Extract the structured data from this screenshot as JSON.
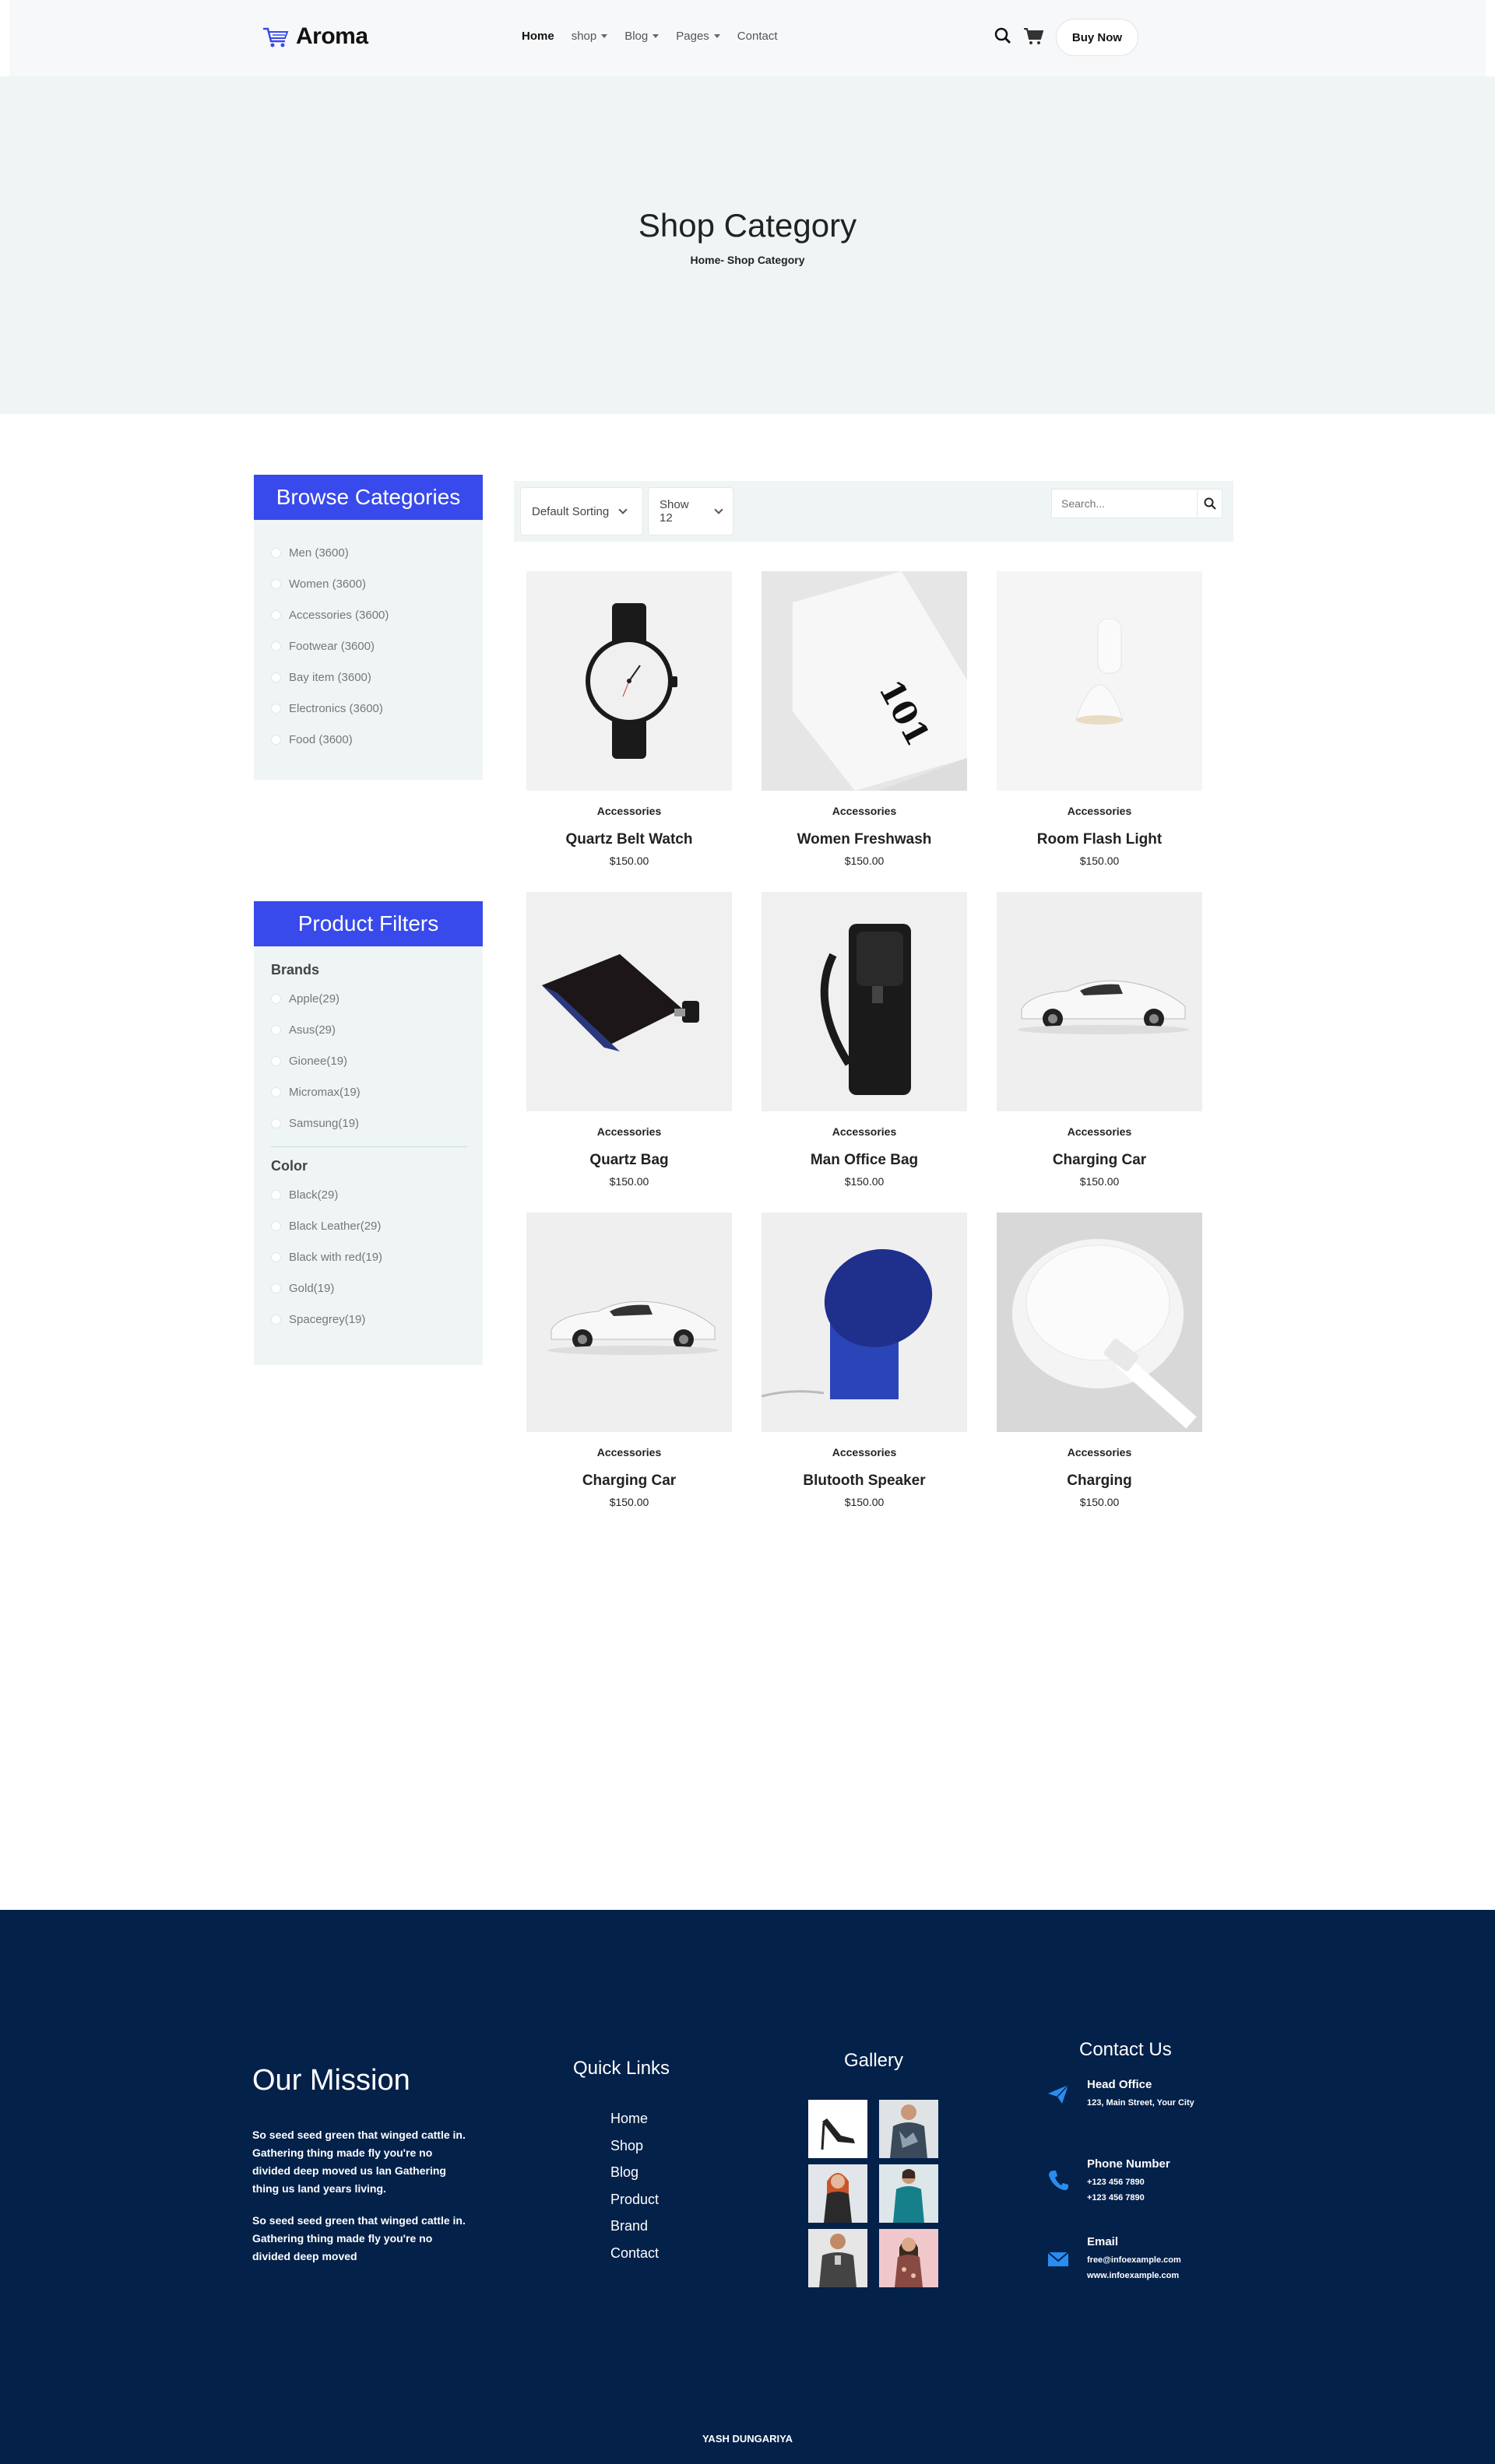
{
  "header": {
    "logo_text": "Aroma",
    "nav": [
      {
        "label": "Home",
        "active": true,
        "dropdown": false
      },
      {
        "label": "shop",
        "active": false,
        "dropdown": true
      },
      {
        "label": "Blog",
        "active": false,
        "dropdown": true
      },
      {
        "label": "Pages",
        "active": false,
        "dropdown": true
      },
      {
        "label": "Contact",
        "active": false,
        "dropdown": false
      }
    ],
    "buy_label": "Buy Now"
  },
  "hero": {
    "title": "Shop Category",
    "breadcrumb": "Home- Shop Category"
  },
  "sidebar": {
    "categories_title": "Browse Categories",
    "categories": [
      {
        "label": "Men (3600)"
      },
      {
        "label": "Women (3600)"
      },
      {
        "label": "Accessories (3600)"
      },
      {
        "label": "Footwear (3600)"
      },
      {
        "label": "Bay item (3600)"
      },
      {
        "label": "Electronics (3600)"
      },
      {
        "label": "Food (3600)"
      }
    ],
    "filters_title": "Product Filters",
    "brands_title": "Brands",
    "brands": [
      {
        "label": "Apple(29)"
      },
      {
        "label": "Asus(29)"
      },
      {
        "label": "Gionee(19)"
      },
      {
        "label": "Micromax(19)"
      },
      {
        "label": "Samsung(19)"
      }
    ],
    "color_title": "Color",
    "colors": [
      {
        "label": "Black(29)"
      },
      {
        "label": "Black Leather(29)"
      },
      {
        "label": "Black with red(19)"
      },
      {
        "label": "Gold(19)"
      },
      {
        "label": "Spacegrey(19)"
      }
    ]
  },
  "toolbar": {
    "sorting": "Default Sorting",
    "show": "Show 12",
    "search_placeholder": "Search..."
  },
  "products": [
    {
      "category": "Accessories",
      "name": "Quartz Belt Watch",
      "price": "$150.00",
      "icon": "watch-image"
    },
    {
      "category": "Accessories",
      "name": "Women Freshwash",
      "price": "$150.00",
      "icon": "tube-image"
    },
    {
      "category": "Accessories",
      "name": "Room Flash Light",
      "price": "$150.00",
      "icon": "lamp-image"
    },
    {
      "category": "Accessories",
      "name": "Quartz Bag",
      "price": "$150.00",
      "icon": "flask-image"
    },
    {
      "category": "Accessories",
      "name": "Man Office Bag",
      "price": "$150.00",
      "icon": "backpack-image"
    },
    {
      "category": "Accessories",
      "name": "Charging Car",
      "price": "$150.00",
      "icon": "car-image"
    },
    {
      "category": "Accessories",
      "name": "Charging Car",
      "price": "$150.00",
      "icon": "car-image"
    },
    {
      "category": "Accessories",
      "name": "Blutooth Speaker",
      "price": "$150.00",
      "icon": "speaker-image"
    },
    {
      "category": "Accessories",
      "name": "Charging",
      "price": "$150.00",
      "icon": "charger-image"
    }
  ],
  "footer": {
    "mission_title": "Our Mission",
    "mission_p1": "So seed seed green that winged cattle in. Gathering thing made fly you're no divided deep moved us lan Gathering thing us land years living.",
    "mission_p2": "So seed seed green that winged cattle in. Gathering thing made fly you're no divided deep moved",
    "links_title": "Quick Links",
    "links": [
      "Home",
      "Shop",
      "Blog",
      "Product",
      "Brand",
      "Contact"
    ],
    "gallery_title": "Gallery",
    "contact_title": "Contact Us",
    "contacts": [
      {
        "title": "Head Office",
        "lines": [
          "123, Main Street, Your City"
        ],
        "icon": "paper-plane-icon"
      },
      {
        "title": "Phone Number",
        "lines": [
          "+123 456 7890",
          "+123 456 7890"
        ],
        "icon": "phone-icon"
      },
      {
        "title": "Email",
        "lines": [
          "free@infoexample.com",
          "www.infoexample.com"
        ],
        "icon": "envelope-icon"
      }
    ],
    "copyright": "YASH DUNGARIYA"
  },
  "colors": {
    "accent": "#384aeb",
    "footer_bg": "#04214a",
    "hero_bg": "#eff5f5",
    "contact_icon": "#2a8cf0"
  }
}
